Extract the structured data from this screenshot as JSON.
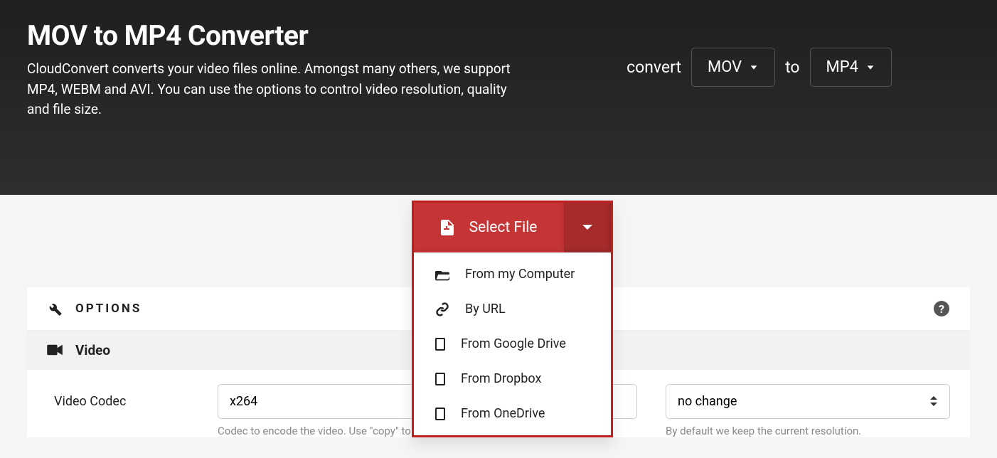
{
  "header": {
    "title": "MOV to MP4 Converter",
    "description": "CloudConvert converts your video files online. Amongst many others, we support MP4, WEBM and AVI. You can use the options to control video resolution, quality and file size."
  },
  "format_bar": {
    "convert_label": "convert",
    "from_format": "MOV",
    "to_label": "to",
    "to_format": "MP4"
  },
  "select_file": {
    "button_label": "Select File",
    "options": [
      {
        "label": "From my Computer",
        "icon": "folder-open"
      },
      {
        "label": "By URL",
        "icon": "link"
      },
      {
        "label": "From Google Drive",
        "icon": "box"
      },
      {
        "label": "From Dropbox",
        "icon": "box"
      },
      {
        "label": "From OneDrive",
        "icon": "box"
      }
    ]
  },
  "options_panel": {
    "title": "OPTIONS",
    "video_section": "Video",
    "video_codec": {
      "label": "Video Codec",
      "value": "x264",
      "hint": "Codec to encode the video. Use \"copy\" to copy the stream without re-encoding."
    },
    "resolution": {
      "value": "no change",
      "hint": "By default we keep the current resolution."
    }
  }
}
